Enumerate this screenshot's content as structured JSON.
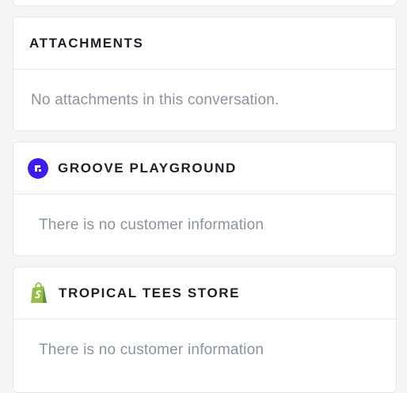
{
  "attachments": {
    "title": "ATTACHMENTS",
    "empty_text": "No attachments in this conversation."
  },
  "groove": {
    "title": "GROOVE PLAYGROUND",
    "icon": "groove-logo-icon",
    "empty_text": "There is no customer information",
    "accent": "#3d1cf0"
  },
  "shopify": {
    "title": "TROPICAL TEES STORE",
    "icon": "shopify-bag-icon",
    "empty_text": "There is no customer information",
    "accent": "#95bf47"
  }
}
